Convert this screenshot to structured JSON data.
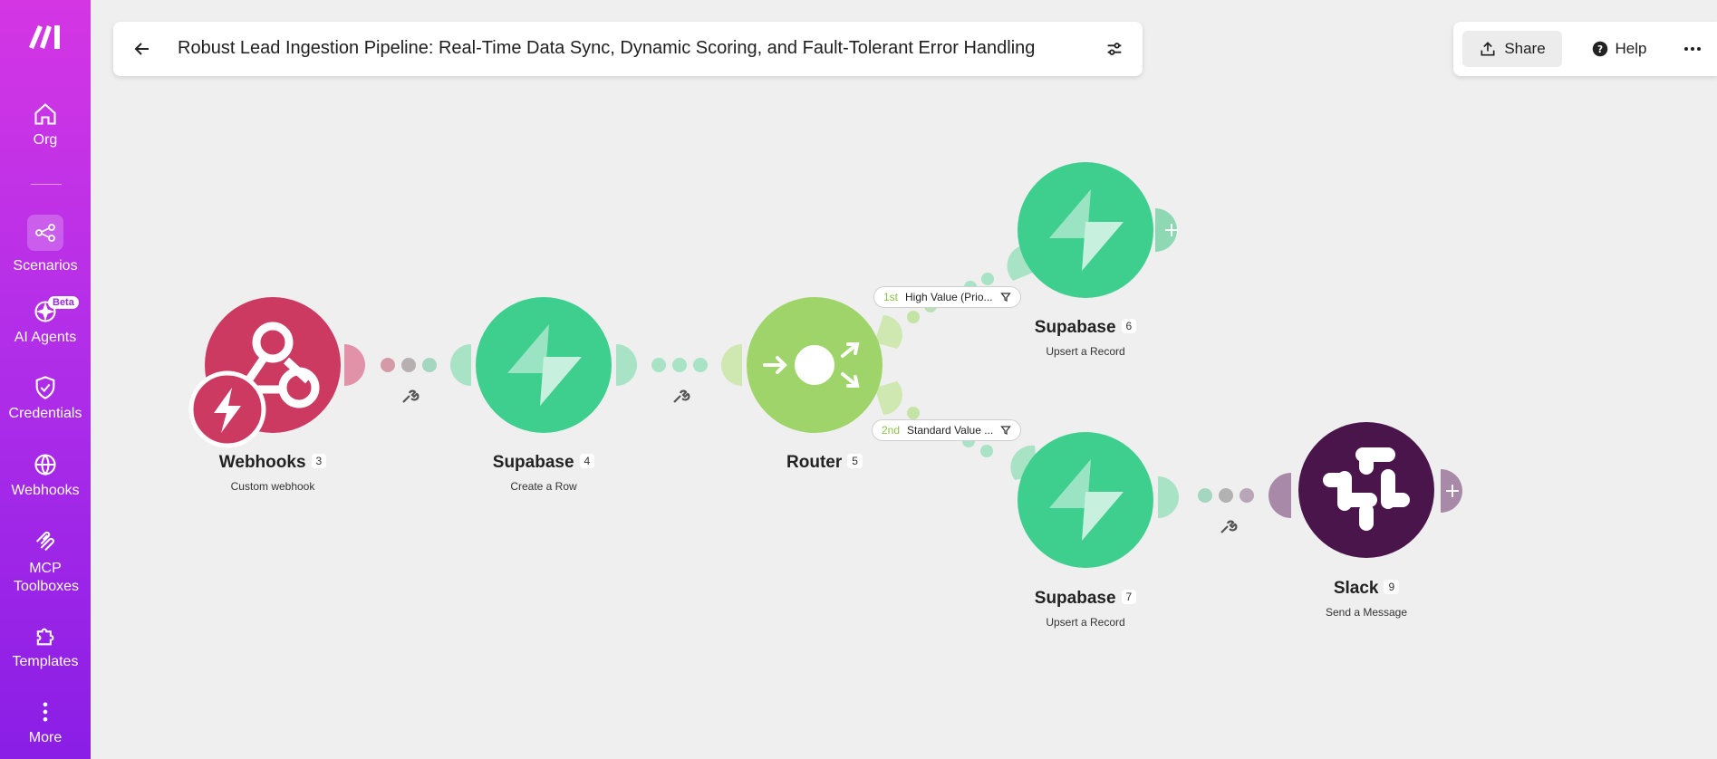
{
  "sidebar": {
    "items": [
      {
        "label": "Org",
        "icon": "home-icon"
      },
      {
        "label": "Scenarios",
        "icon": "scenarios-icon"
      },
      {
        "label": "AI Agents",
        "icon": "ai-agents-icon",
        "badge": "Beta"
      },
      {
        "label": "Credentials",
        "icon": "shield-check-icon"
      },
      {
        "label": "Webhooks",
        "icon": "globe-icon"
      },
      {
        "label": "MCP Toolboxes",
        "icon": "mcp-icon"
      },
      {
        "label": "Templates",
        "icon": "puzzle-icon"
      },
      {
        "label": "More",
        "icon": "more-vertical-icon"
      }
    ]
  },
  "header": {
    "title": "Robust Lead Ingestion Pipeline: Real-Time Data Sync, Dynamic Scoring, and Fault-Tolerant Error Handling"
  },
  "toolbar": {
    "share_label": "Share",
    "help_label": "Help"
  },
  "nodes": [
    {
      "name": "Webhooks",
      "num": "3",
      "sub": "Custom webhook",
      "color": "#cc3a62"
    },
    {
      "name": "Supabase",
      "num": "4",
      "sub": "Create a Row",
      "color": "#3ecf8e"
    },
    {
      "name": "Router",
      "num": "5",
      "sub": "",
      "color": "#9fd46a"
    },
    {
      "name": "Supabase",
      "num": "6",
      "sub": "Upsert a Record",
      "color": "#3ecf8e"
    },
    {
      "name": "Supabase",
      "num": "7",
      "sub": "Upsert a Record",
      "color": "#3ecf8e"
    },
    {
      "name": "Slack",
      "num": "9",
      "sub": "Send a Message",
      "color": "#4a154b"
    }
  ],
  "filters": [
    {
      "order": "1st",
      "label": "High Value (Prio..."
    },
    {
      "order": "2nd",
      "label": "Standard Value ..."
    }
  ]
}
